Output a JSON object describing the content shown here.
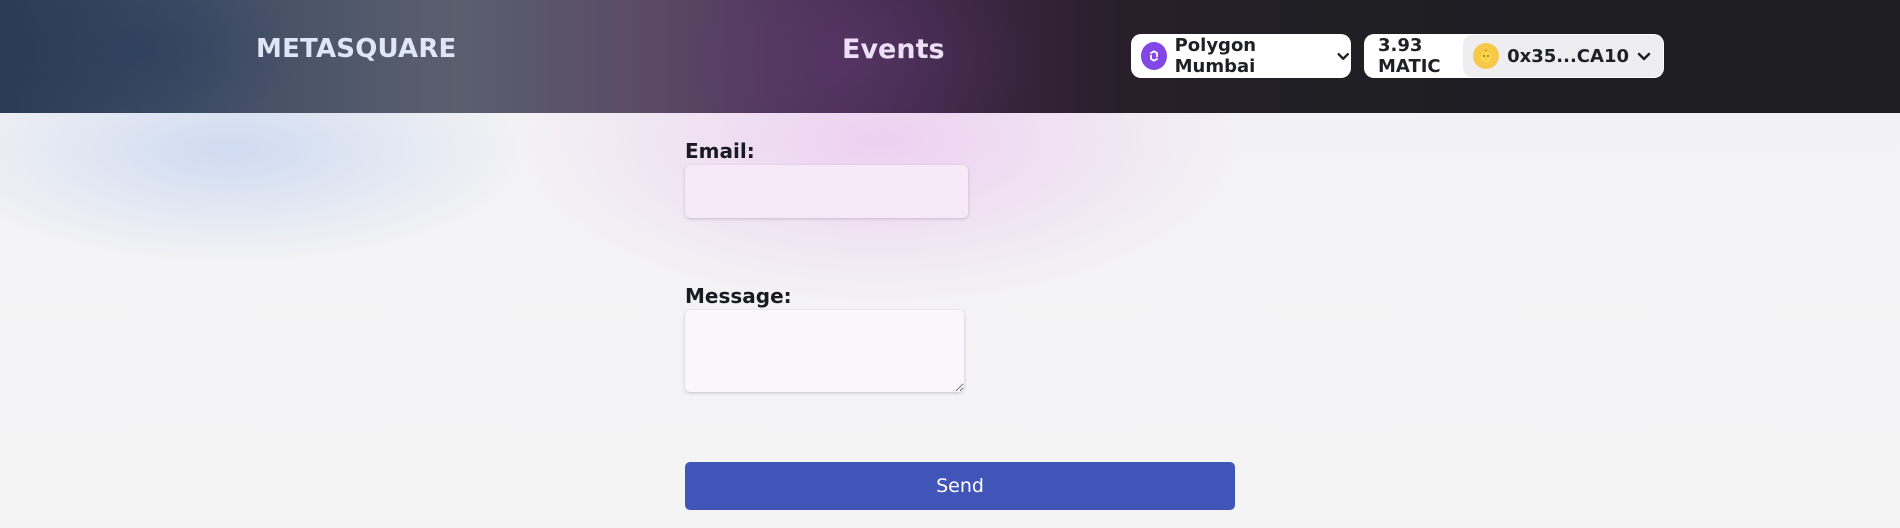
{
  "header": {
    "logo": "METASQUARE",
    "nav": {
      "events_label": "Events"
    },
    "network": {
      "name": "Polygon Mumbai",
      "icon": "polygon-icon"
    },
    "wallet": {
      "balance": "3.93 MATIC",
      "address": "0x35...CA10",
      "avatar": "chick-avatar"
    }
  },
  "form": {
    "email_label": "Email:",
    "email_value": "",
    "message_label": "Message:",
    "message_value": "",
    "send_label": "Send"
  },
  "colors": {
    "accent_button": "#4154b7",
    "network_icon": "#8247e5"
  }
}
